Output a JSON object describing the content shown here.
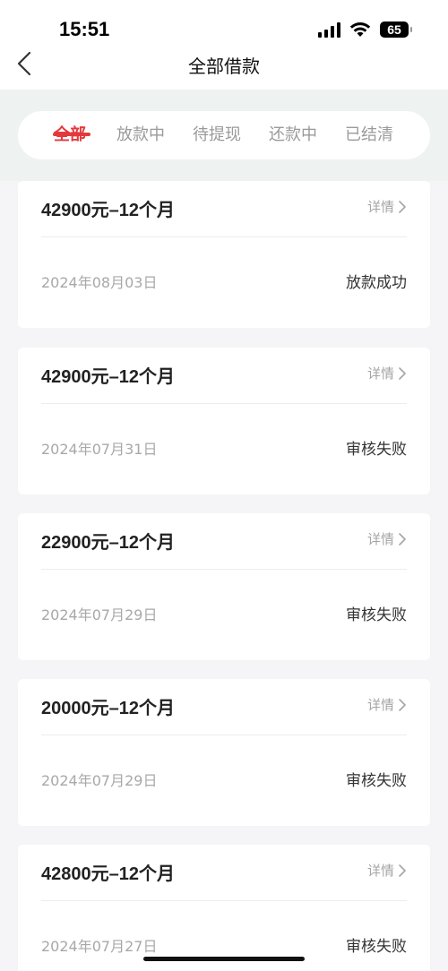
{
  "status_bar": {
    "time": "15:51",
    "battery": "65"
  },
  "nav": {
    "title": "全部借款"
  },
  "tabs": [
    {
      "label": "全部",
      "active": true
    },
    {
      "label": "放款中",
      "active": false
    },
    {
      "label": "待提现",
      "active": false
    },
    {
      "label": "还款中",
      "active": false
    },
    {
      "label": "已结清",
      "active": false
    }
  ],
  "loans": [
    {
      "title": "42900元–12个月",
      "detail": "详情",
      "date": "2024年08月03日",
      "status": "放款成功"
    },
    {
      "title": "42900元–12个月",
      "detail": "详情",
      "date": "2024年07月31日",
      "status": "审核失败"
    },
    {
      "title": "22900元–12个月",
      "detail": "详情",
      "date": "2024年07月29日",
      "status": "审核失败"
    },
    {
      "title": "20000元–12个月",
      "detail": "详情",
      "date": "2024年07月29日",
      "status": "审核失败"
    },
    {
      "title": "42800元–12个月",
      "detail": "详情",
      "date": "2024年07月27日",
      "status": "审核失败"
    }
  ],
  "colors": {
    "accent": "#e4393c",
    "page_bg": "#f5f5f7",
    "tab_bar_bg": "#eef3f1"
  }
}
